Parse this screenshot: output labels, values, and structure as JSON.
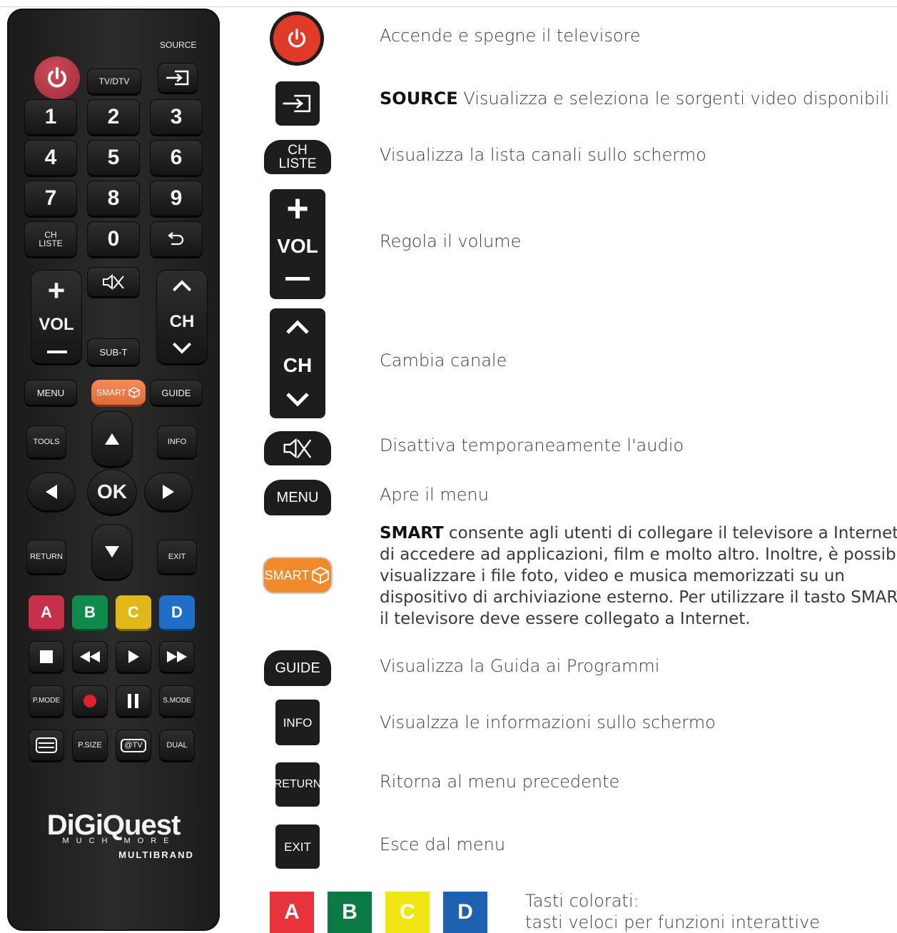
{
  "remote": {
    "source_label": "SOURCE",
    "tvdtv_label": "TV/DTV",
    "digits": [
      "1",
      "2",
      "3",
      "4",
      "5",
      "6",
      "7",
      "8",
      "9",
      "0"
    ],
    "chliste_line1": "CH",
    "chliste_line2": "LISTE",
    "vol_label": "VOL",
    "ch_label": "CH",
    "subt_label": "SUB-T",
    "menu_label": "MENU",
    "smart_label": "SMART",
    "guide_label": "GUIDE",
    "tools_label": "TOOLS",
    "info_label": "INFO",
    "ok_label": "OK",
    "return_label": "RETURN",
    "exit_label": "EXIT",
    "color_keys": [
      {
        "label": "A",
        "color": "#c8304a"
      },
      {
        "label": "B",
        "color": "#0e8a4a"
      },
      {
        "label": "C",
        "color": "#e0b818"
      },
      {
        "label": "D",
        "color": "#1f6fc8"
      }
    ],
    "pmode_label": "P.MODE",
    "smode_label": "S.MODE",
    "psize_label": "P.SIZE",
    "etv_label": "@TV",
    "dual_label": "DUAL",
    "brand_name": "DiGiQuest",
    "brand_tagline": "MUCH MORE",
    "brand_sub": "MULTIBRAND"
  },
  "legend": {
    "power_desc": "Accende e spegne il televisore",
    "source_bold": "SOURCE",
    "source_desc": " Visualizza e seleziona le sorgenti video disponibili",
    "chliste_line1": "CH",
    "chliste_line2": "LISTE",
    "chliste_desc": "Visualizza la lista canali sullo schermo",
    "vol_label": "VOL",
    "vol_desc": "Regola il volume",
    "ch_label": "CH",
    "ch_desc": "Cambia canale",
    "mute_desc": "Disattiva temporaneamente l'audio",
    "menu_label": "MENU",
    "menu_desc": "Apre il menu",
    "smart_label": "SMART",
    "smart_bold": "SMART",
    "smart_line1": " consente agli utenti di collegare il televisore a Internet e",
    "smart_line2": "di accedere ad applicazioni, film e molto altro. Inoltre, è possibile",
    "smart_line3": "visualizzare i file foto, video e musica memorizzati su un",
    "smart_line4": "dispositivo di archiviazione esterno. Per utilizzare il tasto SMART",
    "smart_line5": "il televisore deve essere collegato a Internet.",
    "guide_label": "GUIDE",
    "guide_desc": "Visualizza la Guida ai Programmi",
    "info_label": "INFO",
    "info_desc": "Visualzza le informazioni sullo schermo",
    "return_label": "RETURN",
    "return_desc": "Ritorna al menu precedente",
    "exit_label": "EXIT",
    "exit_desc": "Esce dal menu",
    "color_keys": [
      {
        "label": "A",
        "color": "#e8323c"
      },
      {
        "label": "B",
        "color": "#0c7a45"
      },
      {
        "label": "C",
        "color": "#f0e614"
      },
      {
        "label": "D",
        "color": "#1d62b0"
      }
    ],
    "color_desc_1": "Tasti colorati:",
    "color_desc_2": "tasti veloci per funzioni interattive"
  }
}
